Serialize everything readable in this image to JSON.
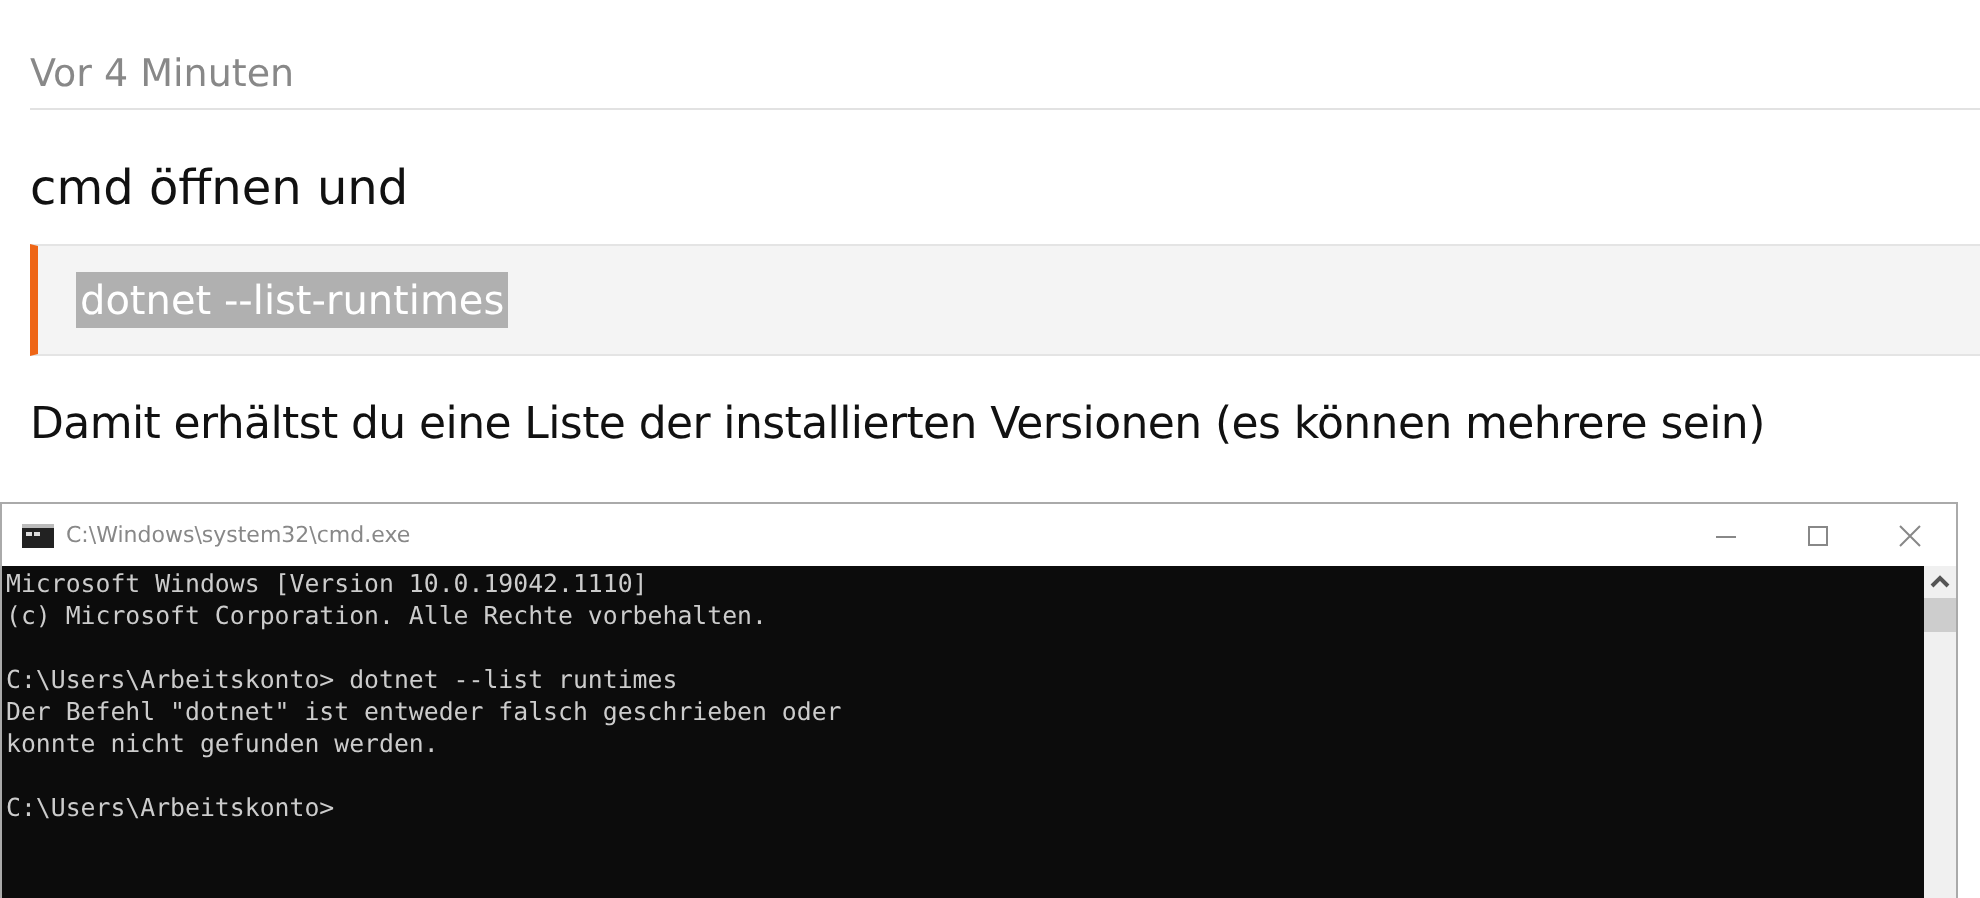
{
  "post": {
    "timestamp": "Vor 4 Minuten",
    "heading": "cmd öffnen und",
    "code": {
      "text": "dotnet --list-runtimes",
      "selected": true
    },
    "paragraph": "Damit erhältst du eine Liste der installierten Versionen (es können mehrere sein)"
  },
  "console_window": {
    "title": "C:\\Windows\\system32\\cmd.exe",
    "blocks": [
      [
        "Microsoft Windows [Version 10.0.19042.1110]",
        "(c) Microsoft Corporation. Alle Rechte vorbehalten."
      ],
      [
        "C:\\Users\\Arbeitskonto> dotnet --list runtimes",
        "Der Befehl \"dotnet\" ist entweder falsch geschrieben oder",
        "konnte nicht gefunden werden."
      ],
      [
        "C:\\Users\\Arbeitskonto>"
      ]
    ]
  }
}
